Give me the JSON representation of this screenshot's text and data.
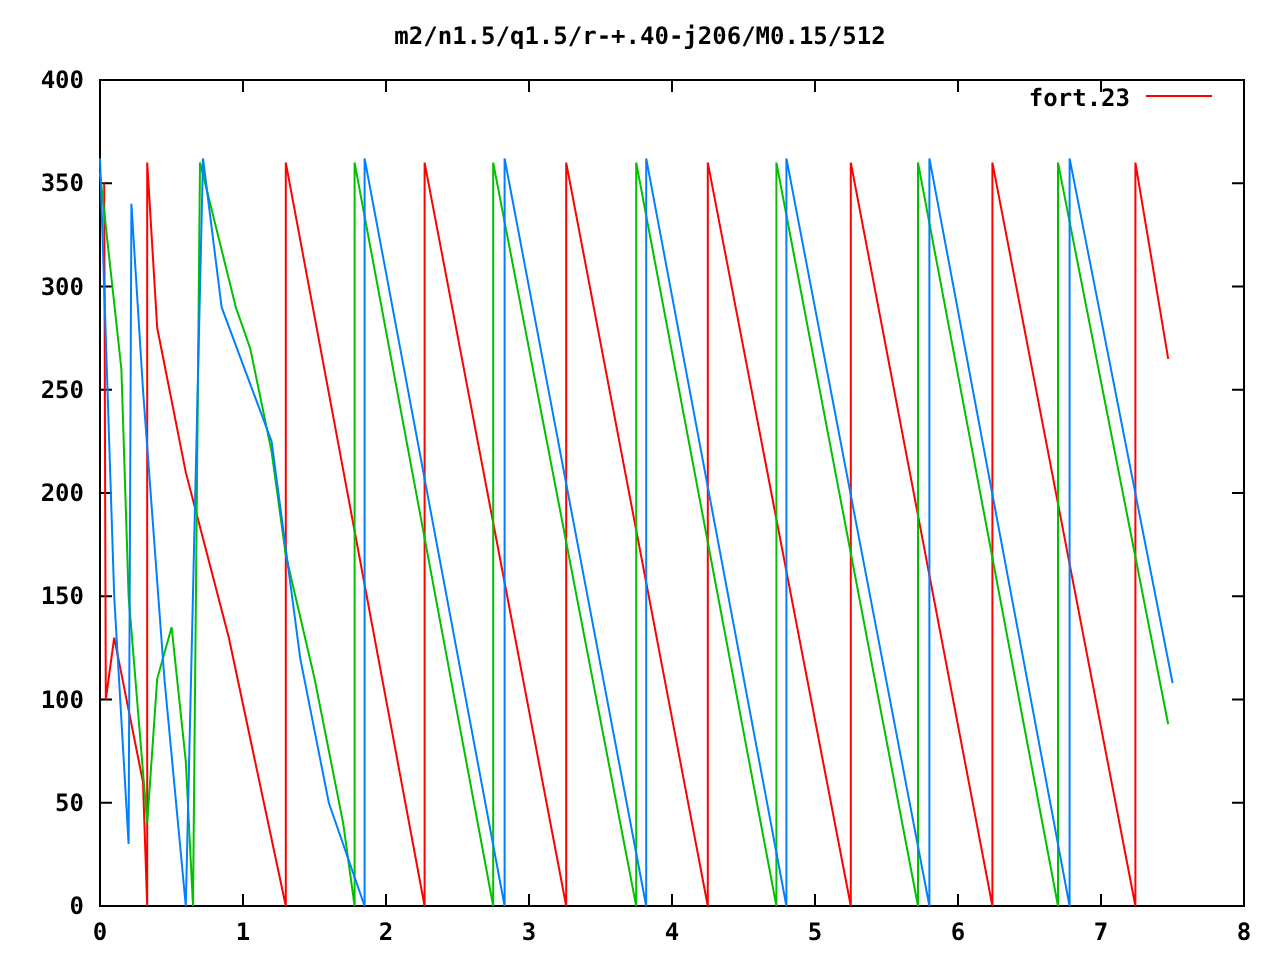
{
  "chart_data": {
    "type": "line",
    "title": "m2/n1.5/q1.5/r-+.40-j206/M0.15/512",
    "xlim": [
      0,
      8
    ],
    "ylim": [
      0,
      400
    ],
    "xticks": [
      0,
      1,
      2,
      3,
      4,
      5,
      6,
      7,
      8
    ],
    "yticks": [
      0,
      50,
      100,
      150,
      200,
      250,
      300,
      350,
      400
    ],
    "series": [
      {
        "name": "fort.23",
        "color": "#ff0000",
        "x": [
          0.03,
          0.04,
          0.1,
          0.3,
          0.33,
          0.33,
          0.4,
          0.6,
          0.9,
          1.3,
          1.3,
          2.27,
          2.27,
          3.26,
          3.26,
          4.25,
          4.25,
          5.25,
          5.25,
          6.24,
          6.24,
          7.24,
          7.24,
          7.47
        ],
        "values": [
          350,
          100,
          130,
          60,
          0,
          360,
          280,
          210,
          130,
          0,
          360,
          0,
          360,
          0,
          360,
          0,
          360,
          0,
          360,
          0,
          360,
          0,
          360,
          265
        ]
      },
      {
        "color": "#00c000",
        "x": [
          0,
          0.15,
          0.2,
          0.33,
          0.4,
          0.5,
          0.6,
          0.65,
          0.7,
          0.95,
          1.05,
          1.2,
          1.3,
          1.5,
          1.7,
          1.78,
          1.78,
          2.75,
          2.75,
          3.75,
          3.75,
          4.73,
          4.73,
          5.72,
          5.72,
          6.7,
          6.7,
          7.47
        ],
        "values": [
          355,
          260,
          150,
          40,
          110,
          135,
          70,
          0,
          360,
          290,
          270,
          220,
          170,
          110,
          40,
          0,
          360,
          0,
          360,
          0,
          360,
          0,
          360,
          0,
          360,
          0,
          360,
          88
        ]
      },
      {
        "color": "#0080ff",
        "x": [
          0,
          0.1,
          0.2,
          0.22,
          0.3,
          0.45,
          0.6,
          0.72,
          0.85,
          1.2,
          1.4,
          1.6,
          1.85,
          1.85,
          2.83,
          2.83,
          3.82,
          3.82,
          4.8,
          4.8,
          5.8,
          5.8,
          6.78,
          6.78,
          7.5
        ],
        "values": [
          362,
          150,
          30,
          340,
          250,
          110,
          0,
          362,
          290,
          225,
          120,
          50,
          0,
          362,
          0,
          362,
          0,
          362,
          0,
          362,
          0,
          362,
          0,
          362,
          108
        ]
      }
    ]
  }
}
